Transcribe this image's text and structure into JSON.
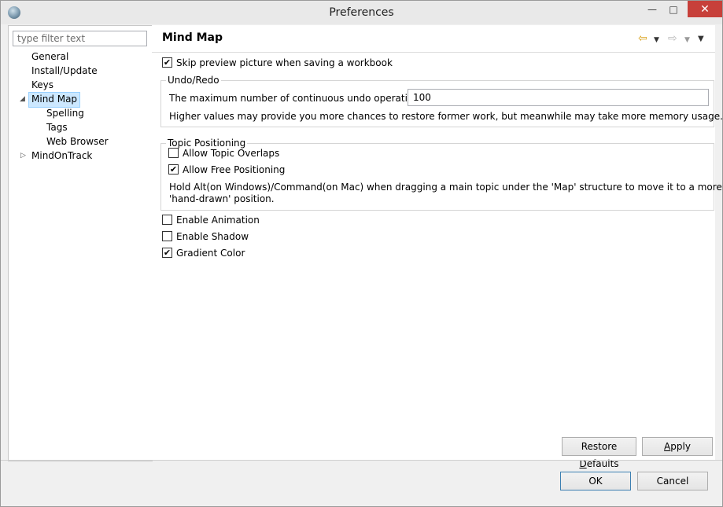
{
  "window": {
    "title": "Preferences",
    "min_glyph": "—",
    "max_glyph": "□",
    "close_glyph": "✕"
  },
  "left": {
    "filter_placeholder": "type filter text",
    "tree": [
      {
        "label": "General"
      },
      {
        "label": "Install/Update"
      },
      {
        "label": "Keys"
      },
      {
        "label": "Mind Map",
        "expanded": true,
        "selected": true
      },
      {
        "label": "Spelling"
      },
      {
        "label": "Tags"
      },
      {
        "label": "Web Browser"
      },
      {
        "label": "MindOnTrack",
        "expanded": false
      }
    ],
    "expanded_glyph": "◢",
    "collapsed_glyph": "▷"
  },
  "page": {
    "title": "Mind Map",
    "back_glyph": "⇦",
    "forward_glyph": "⇨",
    "dropdown_glyph": "▼",
    "skip_preview": {
      "label": "Skip preview picture when saving a workbook",
      "checked": true
    },
    "undo_group": {
      "title": "Undo/Redo",
      "max_label": "The maximum number of continuous undo operations:",
      "max_value": "100",
      "hint": "Higher values may provide you more chances to restore former work, but meanwhile may take more memory usage."
    },
    "topic_group": {
      "title": "Topic Positioning",
      "allow_overlaps": {
        "label": "Allow Topic Overlaps",
        "checked": false
      },
      "allow_free": {
        "label": "Allow Free Positioning",
        "checked": true
      },
      "hint_line1": "Hold Alt(on Windows)/Command(on Mac) when dragging a main topic under the 'Map' structure to move it to a more",
      "hint_line2": "'hand-drawn' position."
    },
    "enable_animation": {
      "label": "Enable Animation",
      "checked": false
    },
    "enable_shadow": {
      "label": "Enable Shadow",
      "checked": false
    },
    "gradient_color": {
      "label": "Gradient Color",
      "checked": true
    },
    "restore_defaults_pre": "Restore ",
    "restore_defaults_u": "D",
    "restore_defaults_post": "efaults",
    "apply_u": "A",
    "apply_post": "pply"
  },
  "footer": {
    "ok_label": "OK",
    "cancel_label": "Cancel"
  },
  "check_glyph": "✔"
}
